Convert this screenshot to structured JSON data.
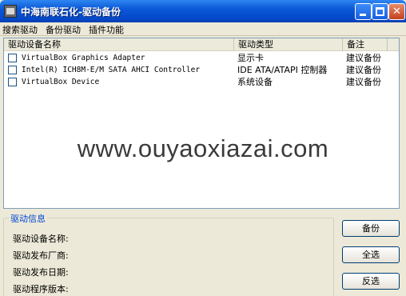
{
  "window": {
    "title": "中海南联石化-驱动备份"
  },
  "menu": [
    "搜索驱动",
    "备份驱动",
    "插件功能"
  ],
  "list": {
    "columns": [
      "驱动设备名称",
      "驱动类型",
      "备注"
    ],
    "rows": [
      {
        "name": "VirtualBox Graphics Adapter",
        "type": "显示卡",
        "note": "建议备份",
        "checked": false
      },
      {
        "name": "Intel(R) ICH8M-E/M SATA AHCI Controller",
        "type": "IDE ATA/ATAPI 控制器",
        "note": "建议备份",
        "checked": false
      },
      {
        "name": "VirtualBox Device",
        "type": "系统设备",
        "note": "建议备份",
        "checked": false
      }
    ]
  },
  "watermark": "www.ouyaoxiazai.com",
  "info": {
    "title": "驱动信息",
    "labels": [
      "驱动设备名称:",
      "驱动发布厂商:",
      "驱动发布日期:",
      "驱动程序版本:"
    ]
  },
  "buttons": {
    "backup": "备份",
    "select_all": "全选",
    "invert": "反选"
  }
}
